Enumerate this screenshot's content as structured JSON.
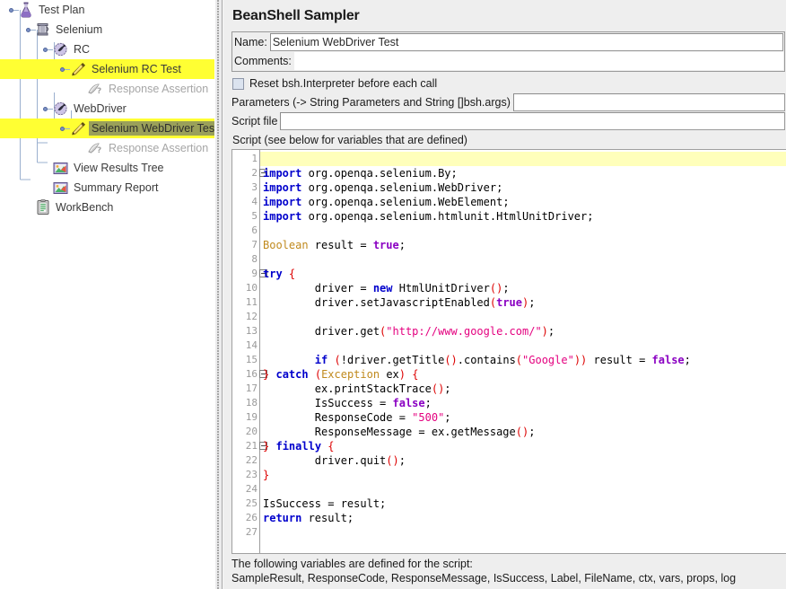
{
  "tree": {
    "nodes": [
      {
        "label": "Test Plan",
        "depth": 0,
        "icon": "flask-icon",
        "highlight": false,
        "selected": false,
        "dim": false,
        "toggle": true
      },
      {
        "label": "Selenium",
        "depth": 1,
        "icon": "thread-group-icon",
        "highlight": false,
        "selected": false,
        "dim": false,
        "toggle": true
      },
      {
        "label": "RC",
        "depth": 2,
        "icon": "controller-icon",
        "highlight": false,
        "selected": false,
        "dim": false,
        "toggle": true
      },
      {
        "label": "Selenium RC Test",
        "depth": 3,
        "icon": "beanshell-icon",
        "highlight": true,
        "selected": false,
        "dim": false,
        "toggle": true
      },
      {
        "label": "Response Assertion",
        "depth": 4,
        "icon": "assertion-icon",
        "highlight": false,
        "selected": false,
        "dim": true,
        "toggle": false
      },
      {
        "label": "WebDriver",
        "depth": 2,
        "icon": "controller-icon",
        "highlight": false,
        "selected": false,
        "dim": false,
        "toggle": true
      },
      {
        "label": "Selenium WebDriver Test",
        "depth": 3,
        "icon": "beanshell-icon",
        "highlight": true,
        "selected": true,
        "dim": false,
        "toggle": true
      },
      {
        "label": "Response Assertion",
        "depth": 4,
        "icon": "assertion-icon",
        "highlight": false,
        "selected": false,
        "dim": true,
        "toggle": false
      },
      {
        "label": "View Results Tree",
        "depth": 2,
        "icon": "results-tree-icon",
        "highlight": false,
        "selected": false,
        "dim": false,
        "toggle": false
      },
      {
        "label": "Summary Report",
        "depth": 2,
        "icon": "results-tree-icon",
        "highlight": false,
        "selected": false,
        "dim": false,
        "toggle": false
      },
      {
        "label": "WorkBench",
        "depth": 1,
        "icon": "workbench-icon",
        "highlight": false,
        "selected": false,
        "dim": false,
        "toggle": false
      }
    ],
    "highlight_color": "#ffff33",
    "selection_color": "#9aa05a"
  },
  "panel": {
    "title": "BeanShell Sampler",
    "name_label": "Name:",
    "name_value": "Selenium WebDriver Test",
    "comments_label": "Comments:",
    "comments_value": "",
    "reset_checkbox_label": "Reset bsh.Interpreter before each call",
    "reset_checkbox_checked": false,
    "parameters_label": "Parameters (-> String Parameters and String []bsh.args)",
    "parameters_value": "",
    "script_file_label": "Script file",
    "script_file_value": "",
    "script_section_label": "Script (see below for variables that are defined)"
  },
  "editor": {
    "current_line": 1,
    "fold_lines": [
      2,
      9,
      16,
      21
    ],
    "lines": [
      {
        "n": 1,
        "tokens": []
      },
      {
        "n": 2,
        "tokens": [
          {
            "t": "import",
            "c": "k"
          },
          {
            "t": " org.openqa.selenium.By;",
            "c": "pl"
          }
        ]
      },
      {
        "n": 3,
        "tokens": [
          {
            "t": "import",
            "c": "k"
          },
          {
            "t": " org.openqa.selenium.WebDriver;",
            "c": "pl"
          }
        ]
      },
      {
        "n": 4,
        "tokens": [
          {
            "t": "import",
            "c": "k"
          },
          {
            "t": " org.openqa.selenium.WebElement;",
            "c": "pl"
          }
        ]
      },
      {
        "n": 5,
        "tokens": [
          {
            "t": "import",
            "c": "k"
          },
          {
            "t": " org.openqa.selenium.htmlunit.HtmlUnitDriver;",
            "c": "pl"
          }
        ]
      },
      {
        "n": 6,
        "tokens": []
      },
      {
        "n": 7,
        "tokens": [
          {
            "t": "Boolean",
            "c": "ty"
          },
          {
            "t": " result = ",
            "c": "pl"
          },
          {
            "t": "true",
            "c": "lit"
          },
          {
            "t": ";",
            "c": "pl"
          }
        ]
      },
      {
        "n": 8,
        "tokens": []
      },
      {
        "n": 9,
        "tokens": [
          {
            "t": "try",
            "c": "k"
          },
          {
            "t": " ",
            "c": "pl"
          },
          {
            "t": "{",
            "c": "p"
          }
        ]
      },
      {
        "n": 10,
        "tokens": [
          {
            "t": "        driver = ",
            "c": "pl"
          },
          {
            "t": "new",
            "c": "k"
          },
          {
            "t": " HtmlUnitDriver",
            "c": "pl"
          },
          {
            "t": "()",
            "c": "p"
          },
          {
            "t": ";",
            "c": "pl"
          }
        ]
      },
      {
        "n": 11,
        "tokens": [
          {
            "t": "        driver.setJavascriptEnabled",
            "c": "pl"
          },
          {
            "t": "(",
            "c": "p"
          },
          {
            "t": "true",
            "c": "lit"
          },
          {
            "t": ")",
            "c": "p"
          },
          {
            "t": ";",
            "c": "pl"
          }
        ]
      },
      {
        "n": 12,
        "tokens": []
      },
      {
        "n": 13,
        "tokens": [
          {
            "t": "        driver.get",
            "c": "pl"
          },
          {
            "t": "(",
            "c": "p"
          },
          {
            "t": "\"http://www.google.com/\"",
            "c": "s"
          },
          {
            "t": ")",
            "c": "p"
          },
          {
            "t": ";",
            "c": "pl"
          }
        ]
      },
      {
        "n": 14,
        "tokens": []
      },
      {
        "n": 15,
        "tokens": [
          {
            "t": "        ",
            "c": "pl"
          },
          {
            "t": "if",
            "c": "k"
          },
          {
            "t": " ",
            "c": "pl"
          },
          {
            "t": "(",
            "c": "p"
          },
          {
            "t": "!driver.getTitle",
            "c": "pl"
          },
          {
            "t": "()",
            "c": "p"
          },
          {
            "t": ".contains",
            "c": "pl"
          },
          {
            "t": "(",
            "c": "p"
          },
          {
            "t": "\"Google\"",
            "c": "s"
          },
          {
            "t": "))",
            "c": "p"
          },
          {
            "t": " result = ",
            "c": "pl"
          },
          {
            "t": "false",
            "c": "lit"
          },
          {
            "t": ";",
            "c": "pl"
          }
        ]
      },
      {
        "n": 16,
        "tokens": [
          {
            "t": "}",
            "c": "p"
          },
          {
            "t": " ",
            "c": "pl"
          },
          {
            "t": "catch",
            "c": "k"
          },
          {
            "t": " ",
            "c": "pl"
          },
          {
            "t": "(",
            "c": "p"
          },
          {
            "t": "Exception",
            "c": "ty"
          },
          {
            "t": " ex",
            "c": "pl"
          },
          {
            "t": ")",
            "c": "p"
          },
          {
            "t": " ",
            "c": "pl"
          },
          {
            "t": "{",
            "c": "p"
          }
        ]
      },
      {
        "n": 17,
        "tokens": [
          {
            "t": "        ex.printStackTrace",
            "c": "pl"
          },
          {
            "t": "()",
            "c": "p"
          },
          {
            "t": ";",
            "c": "pl"
          }
        ]
      },
      {
        "n": 18,
        "tokens": [
          {
            "t": "        IsSuccess = ",
            "c": "pl"
          },
          {
            "t": "false",
            "c": "lit"
          },
          {
            "t": ";",
            "c": "pl"
          }
        ]
      },
      {
        "n": 19,
        "tokens": [
          {
            "t": "        ResponseCode = ",
            "c": "pl"
          },
          {
            "t": "\"500\"",
            "c": "s"
          },
          {
            "t": ";",
            "c": "pl"
          }
        ]
      },
      {
        "n": 20,
        "tokens": [
          {
            "t": "        ResponseMessage = ex.getMessage",
            "c": "pl"
          },
          {
            "t": "()",
            "c": "p"
          },
          {
            "t": ";",
            "c": "pl"
          }
        ]
      },
      {
        "n": 21,
        "tokens": [
          {
            "t": "}",
            "c": "p"
          },
          {
            "t": " ",
            "c": "pl"
          },
          {
            "t": "finally",
            "c": "k"
          },
          {
            "t": " ",
            "c": "pl"
          },
          {
            "t": "{",
            "c": "p"
          }
        ]
      },
      {
        "n": 22,
        "tokens": [
          {
            "t": "        driver.quit",
            "c": "pl"
          },
          {
            "t": "()",
            "c": "p"
          },
          {
            "t": ";",
            "c": "pl"
          }
        ]
      },
      {
        "n": 23,
        "tokens": [
          {
            "t": "}",
            "c": "p"
          }
        ]
      },
      {
        "n": 24,
        "tokens": []
      },
      {
        "n": 25,
        "tokens": [
          {
            "t": "IsSuccess = result;",
            "c": "pl"
          }
        ]
      },
      {
        "n": 26,
        "tokens": [
          {
            "t": "return",
            "c": "k"
          },
          {
            "t": " result;",
            "c": "pl"
          }
        ]
      },
      {
        "n": 27,
        "tokens": []
      }
    ]
  },
  "footer": {
    "line1": "The following variables are defined for the script:",
    "line2": "SampleResult, ResponseCode, ResponseMessage, IsSuccess, Label, FileName, ctx, vars, props, log"
  }
}
